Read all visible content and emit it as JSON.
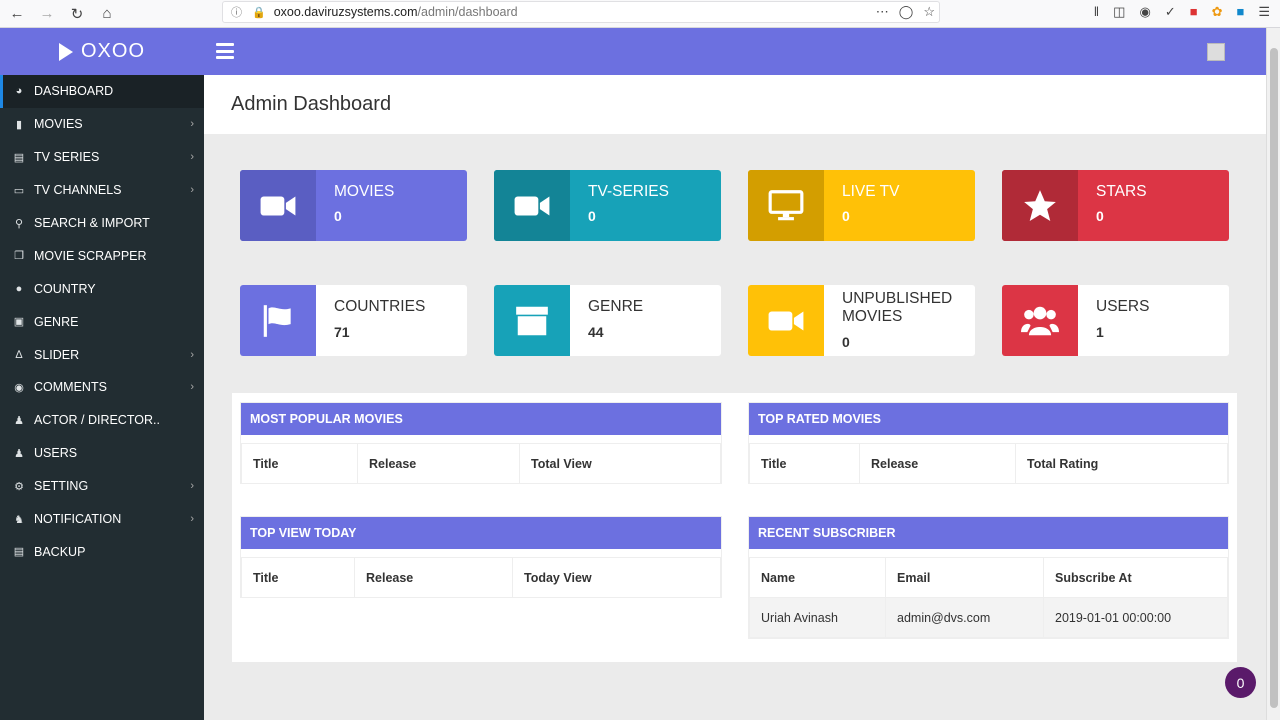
{
  "browser": {
    "url_host": "oxoo.daviruzsystems.com",
    "url_path": "/admin/dashboard"
  },
  "app": {
    "logo_text": "OXOO"
  },
  "sidebar": {
    "items": [
      {
        "label": "DASHBOARD",
        "icon": "tachometer-icon",
        "chevron": false
      },
      {
        "label": "MOVIES",
        "icon": "video-camera-icon",
        "chevron": true
      },
      {
        "label": "TV SERIES",
        "icon": "film-icon",
        "chevron": true
      },
      {
        "label": "TV CHANNELS",
        "icon": "desktop-icon",
        "chevron": true
      },
      {
        "label": "SEARCH & IMPORT",
        "icon": "search-icon",
        "chevron": false
      },
      {
        "label": "MOVIE SCRAPPER",
        "icon": "copy-icon",
        "chevron": false
      },
      {
        "label": "COUNTRY",
        "icon": "globe-icon",
        "chevron": false
      },
      {
        "label": "GENRE",
        "icon": "archive-icon",
        "chevron": false
      },
      {
        "label": "SLIDER",
        "icon": "sliders-icon",
        "chevron": true
      },
      {
        "label": "COMMENTS",
        "icon": "comment-icon",
        "chevron": true
      },
      {
        "label": "ACTOR / DIRECTOR..",
        "icon": "users-icon",
        "chevron": false
      },
      {
        "label": "USERS",
        "icon": "user-icon",
        "chevron": false
      },
      {
        "label": "SETTING",
        "icon": "cogs-icon",
        "chevron": true
      },
      {
        "label": "NOTIFICATION",
        "icon": "bell-icon",
        "chevron": true
      },
      {
        "label": "BACKUP",
        "icon": "database-icon",
        "chevron": false
      }
    ]
  },
  "page": {
    "title": "Admin Dashboard"
  },
  "stats_row1": [
    {
      "label": "MOVIES",
      "value": "0",
      "color": "#6c70e0",
      "icon_bg": "#5a5ec2",
      "icon": "video-camera-icon"
    },
    {
      "label": "TV-SERIES",
      "value": "0",
      "color": "#17a2b8",
      "icon_bg": "#138496",
      "icon": "video-camera-icon"
    },
    {
      "label": "LIVE TV",
      "value": "0",
      "color": "#ffc107",
      "icon_bg": "#d39e00",
      "icon": "desktop-icon"
    },
    {
      "label": "STARS",
      "value": "0",
      "color": "#dc3545",
      "icon_bg": "#b02a37",
      "icon": "star-icon"
    }
  ],
  "stats_row2": [
    {
      "label": "COUNTRIES",
      "value": "71",
      "icon_bg": "#6c70e0",
      "icon": "flag-icon"
    },
    {
      "label": "GENRE",
      "value": "44",
      "icon_bg": "#17a2b8",
      "icon": "archive-icon"
    },
    {
      "label": "UNPUBLISHED MOVIES",
      "value": "0",
      "icon_bg": "#ffc107",
      "icon": "video-camera-icon"
    },
    {
      "label": "USERS",
      "value": "1",
      "icon_bg": "#dc3545",
      "icon": "users-icon"
    }
  ],
  "tables": {
    "popular": {
      "title": "MOST POPULAR MOVIES",
      "columns": [
        "Title",
        "Release",
        "Total View"
      ]
    },
    "rated": {
      "title": "TOP RATED MOVIES",
      "columns": [
        "Title",
        "Release",
        "Total Rating"
      ]
    },
    "today": {
      "title": "TOP VIEW TODAY",
      "columns": [
        "Title",
        "Release",
        "Today View"
      ]
    },
    "subscriber": {
      "title": "RECENT SUBSCRIBER",
      "columns": [
        "Name",
        "Email",
        "Subscribe At"
      ],
      "rows": [
        [
          "Uriah Avinash",
          "admin@dvs.com",
          "2019-01-01 00:00:00"
        ]
      ]
    }
  },
  "fab": {
    "count": "0"
  }
}
